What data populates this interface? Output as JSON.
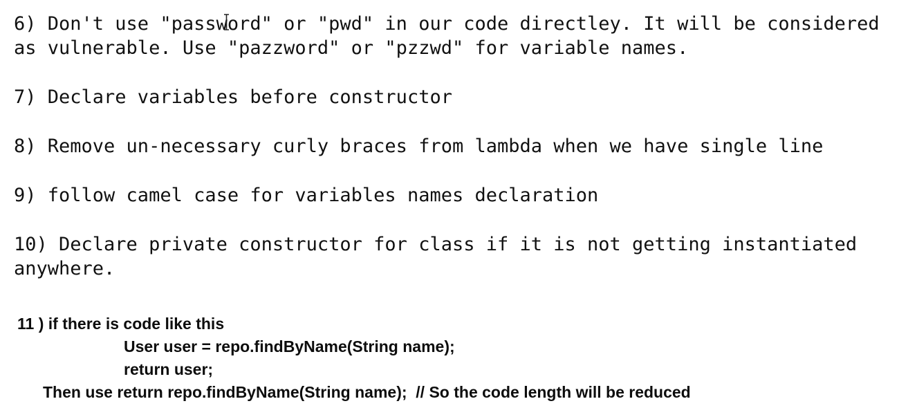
{
  "rules": {
    "rule6_line1": "6) Don't use \"password\" or \"pwd\" in our code directley. It will be considered",
    "rule6_line2": "as vulnerable. Use \"pazzword\" or \"pzzwd\" for variable names.",
    "rule7": "7) Declare variables before constructor",
    "rule8": "8) Remove un-necessary curly braces from lambda when we have single line",
    "rule9": "9) follow camel case for variables names declaration",
    "rule10_line1": "10) Declare private constructor for class if it is not getting instantiated",
    "rule10_line2": "anywhere."
  },
  "rule11": {
    "heading": "11 ) if there is code like this",
    "code_line1": "User user = repo.findByName(String name);",
    "code_line2": "return user;",
    "advice": "Then use return repo.findByName(String name);  // So the code length will be reduced"
  },
  "icons": {
    "cursor": "text-cursor-icon"
  }
}
